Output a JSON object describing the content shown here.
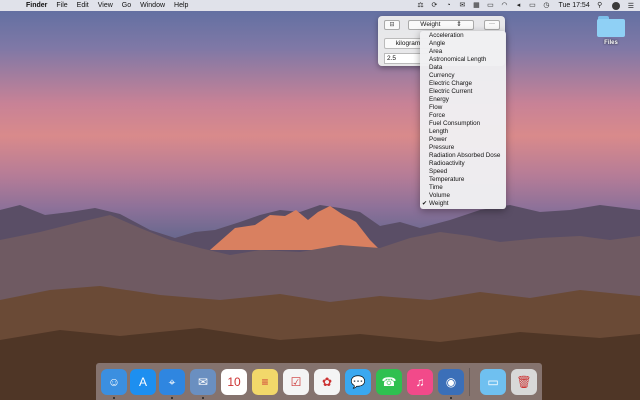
{
  "menubar": {
    "apple": "",
    "items": [
      "Finder",
      "File",
      "Edit",
      "View",
      "Go",
      "Window",
      "Help"
    ],
    "time": "Tue 17:54",
    "right_icons": [
      "converter-icon",
      "sync-icon",
      "timer-icon",
      "mail-icon",
      "grid-icon",
      "display-icon",
      "wifi-icon",
      "volume-icon",
      "battery-icon",
      "clock-icon",
      "spotlight-icon",
      "user-icon",
      "notification-icon"
    ]
  },
  "converter": {
    "category_selected": "Weight",
    "unit": "kilogram",
    "input_value": "2.5",
    "more_label": "···"
  },
  "dropdown": {
    "items": [
      "Acceleration",
      "Angle",
      "Area",
      "Astronomical Length",
      "Data",
      "Currency",
      "Electric Charge",
      "Electric Current",
      "Energy",
      "Flow",
      "Force",
      "Fuel Consumption",
      "Length",
      "Power",
      "Pressure",
      "Radiation Absorbed Dose",
      "Radioactivity",
      "Speed",
      "Temperature",
      "Time",
      "Volume",
      "Weight"
    ],
    "checked": "Weight",
    "check_mark": "✔"
  },
  "desktop": {
    "folder_label": "Files"
  },
  "dock": {
    "apps": [
      {
        "name": "Finder",
        "color": "#3b8fe0",
        "glyph": "☺"
      },
      {
        "name": "App Store",
        "color": "#1d8ff0",
        "glyph": "A"
      },
      {
        "name": "Safari",
        "color": "#2f86e0",
        "glyph": "⌖"
      },
      {
        "name": "Mail",
        "color": "#6a8fc0",
        "glyph": "✉"
      },
      {
        "name": "Calendar",
        "color": "#ffffff",
        "glyph": "10"
      },
      {
        "name": "Notes",
        "color": "#f2d86a",
        "glyph": "≡"
      },
      {
        "name": "Reminders",
        "color": "#f4f4f4",
        "glyph": "☑"
      },
      {
        "name": "Photos",
        "color": "#f4f4f4",
        "glyph": "✿"
      },
      {
        "name": "Messages",
        "color": "#3aa8f0",
        "glyph": "💬"
      },
      {
        "name": "FaceTime",
        "color": "#2fc050",
        "glyph": "☎"
      },
      {
        "name": "iTunes",
        "color": "#f24a8a",
        "glyph": "♫"
      },
      {
        "name": "Tweetbot",
        "color": "#3b6fb8",
        "glyph": "◉"
      },
      {
        "name": "Downloads",
        "color": "#6fc0f0",
        "glyph": "▭"
      },
      {
        "name": "Trash",
        "color": "#d8d8d8",
        "glyph": "🗑"
      }
    ]
  }
}
